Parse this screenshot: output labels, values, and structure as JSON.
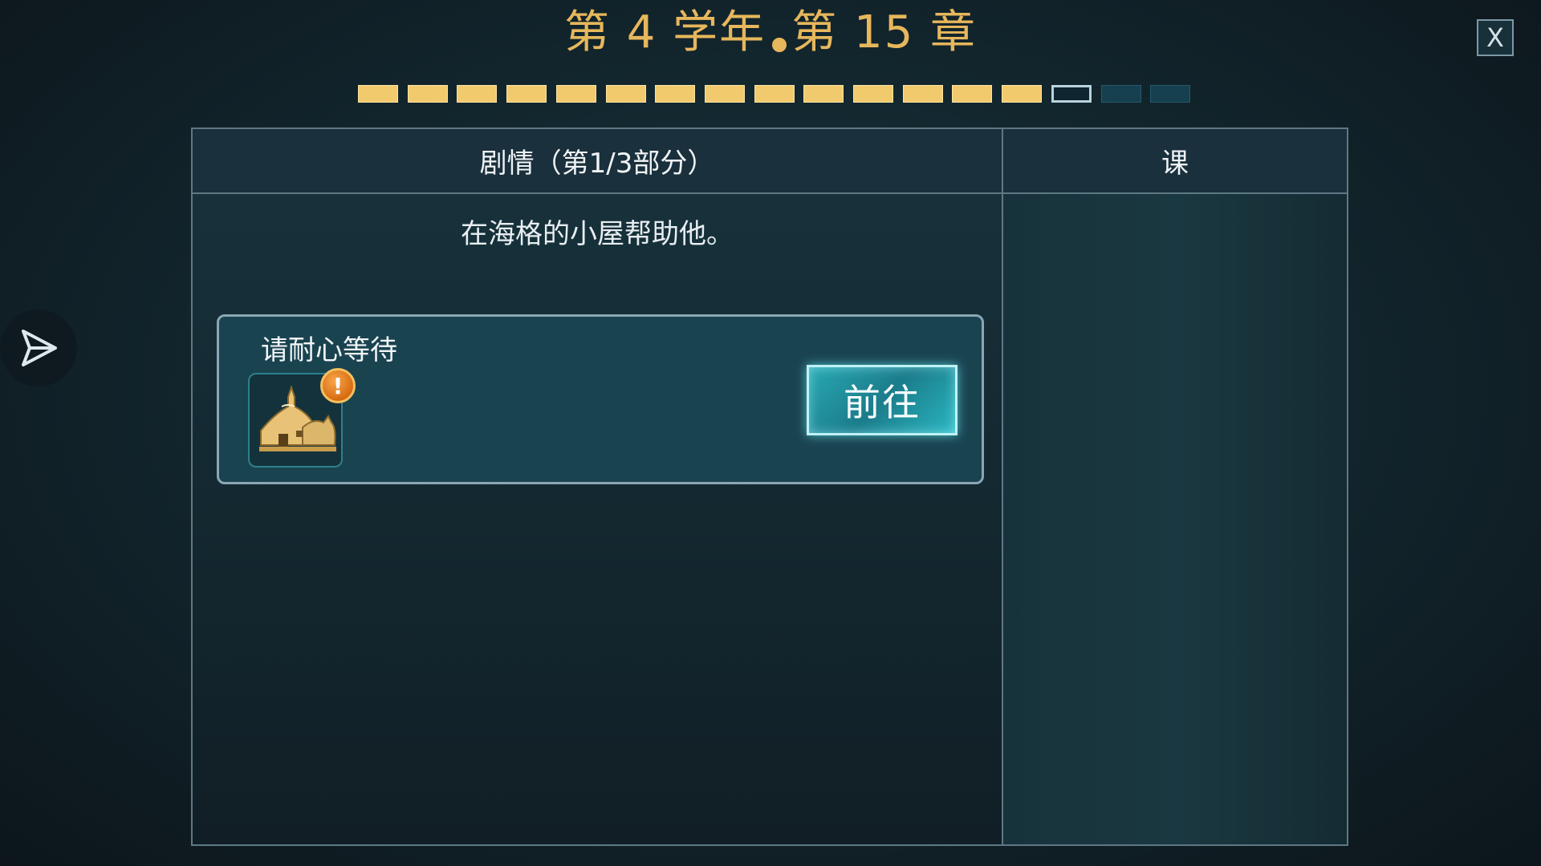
{
  "header": {
    "year_text": "第 4 学年",
    "chapter_text": "第 15 章",
    "close_label": "X"
  },
  "progress": {
    "total": 17,
    "completed": 14,
    "current_index": 15
  },
  "tabs": {
    "story_label": "剧情（第1/3部分）",
    "lesson_label": "课"
  },
  "story": {
    "objective": "在海格的小屋帮助他。",
    "quest": {
      "label": "请耐心等待",
      "icon": "hagrid-hut-icon",
      "alert_icon": "!",
      "go_button_label": "前往"
    }
  },
  "colors": {
    "gold": "#e6b75c",
    "segment_done": "#f2ca6e",
    "segment_todo": "#16404f",
    "button_teal": "#29a9b4",
    "alert_orange": "#d86b12"
  }
}
